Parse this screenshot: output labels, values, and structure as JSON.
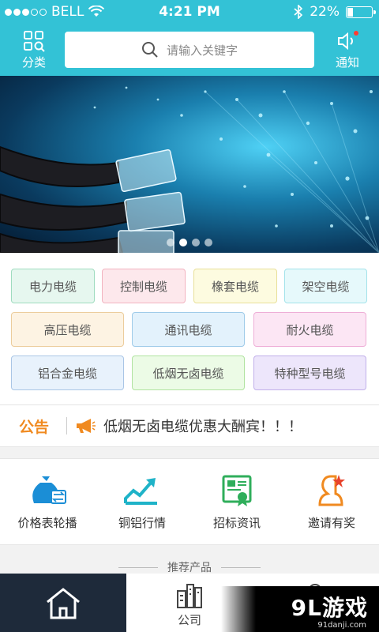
{
  "status_bar": {
    "carrier": "BELL",
    "time": "4:21 PM",
    "battery": "22%",
    "battery_level": 0.22
  },
  "header": {
    "category_label": "分类",
    "search_placeholder": "请输入关键字",
    "notice_label": "通知",
    "accent_color": "#33c2d6"
  },
  "banner": {
    "page_count": 4,
    "active_page": 1
  },
  "tags": [
    {
      "label": "电力电缆",
      "bg": "#e6f7ef",
      "border": "#9fdcbf"
    },
    {
      "label": "控制电缆",
      "bg": "#fde8ec",
      "border": "#f2b3c0"
    },
    {
      "label": "橡套电缆",
      "bg": "#fdfbe0",
      "border": "#e8e09a"
    },
    {
      "label": "架空电缆",
      "bg": "#e6f9fb",
      "border": "#a3e3ea"
    },
    {
      "label": "高压电缆",
      "bg": "#fdf3e3",
      "border": "#eccd9d"
    },
    {
      "label": "通讯电缆",
      "bg": "#e3f2fc",
      "border": "#9fcbe9"
    },
    {
      "label": "耐火电缆",
      "bg": "#fce6f4",
      "border": "#eeaed7"
    },
    {
      "label": "铝合金电缆",
      "bg": "#e8f2fc",
      "border": "#aac6e6"
    },
    {
      "label": "低烟无卤电缆",
      "bg": "#ecfbe6",
      "border": "#b1e3a0"
    },
    {
      "label": "特种型号电缆",
      "bg": "#ede6fb",
      "border": "#c1b0ea"
    }
  ],
  "announcement": {
    "label": "公告",
    "text": "低烟无卤电缆优惠大酬宾！！！",
    "color": "#f08a20"
  },
  "quick_links": [
    {
      "label": "价格表轮播",
      "icon": "money-bag-icon"
    },
    {
      "label": "铜铝行情",
      "icon": "trend-chart-icon"
    },
    {
      "label": "招标资讯",
      "icon": "certificate-icon"
    },
    {
      "label": "邀请有奖",
      "icon": "user-star-icon"
    }
  ],
  "recommend_title": "推荐产品",
  "tab_bar": {
    "home_icon": "home-icon",
    "company_label": "公司",
    "company_icon": "building-icon"
  },
  "watermark": {
    "brand": "9L游戏",
    "url": "91danji.com"
  }
}
